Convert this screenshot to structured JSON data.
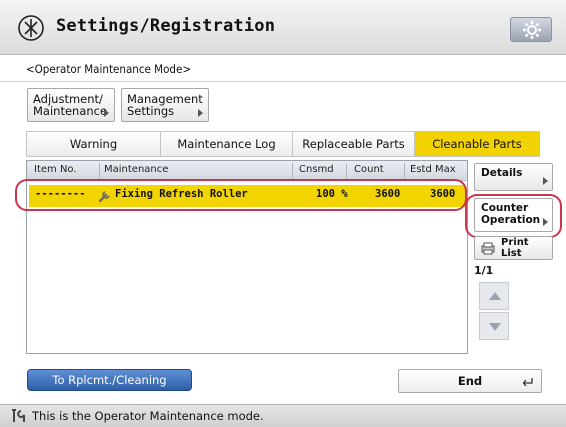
{
  "header": {
    "title": "Settings/Registration",
    "icon": "settings-registration-icon",
    "gear_button_icon": "gear-icon"
  },
  "mode_label": "<Operator Maintenance Mode>",
  "menu": {
    "adjustment_line1": "Adjustment/",
    "adjustment_line2": "Maintenance",
    "management_line1": "Management",
    "management_line2": "Settings"
  },
  "tabs": [
    {
      "label": "Warning",
      "active": false
    },
    {
      "label": "Maintenance Log",
      "active": false
    },
    {
      "label": "Replaceable Parts",
      "active": false
    },
    {
      "label": "Cleanable Parts",
      "active": true
    }
  ],
  "list": {
    "columns": [
      "Item No.",
      "Maintenance",
      "Cnsmd",
      "Count",
      "Estd Max"
    ],
    "rows": [
      {
        "item_no": "--------",
        "icon": "wrench-icon",
        "maintenance": "Fixing Refresh Roller",
        "cnsmd": "100 %",
        "count": "3600",
        "estd_max": "3600",
        "selected": true
      }
    ]
  },
  "side_buttons": {
    "details": "Details",
    "counter_line1": "Counter",
    "counter_line2": "Operation",
    "print_line1": "Print",
    "print_line2": "List"
  },
  "page_indicator": "1/1",
  "bottom": {
    "rplc_button": "To Rplcmt./Cleaning",
    "end_button": "End"
  },
  "status": {
    "text": "This is the Operator Maintenance mode.",
    "icon": "tools-icon"
  },
  "colors": {
    "accent_yellow": "#f2d200",
    "highlight_ring": "#c8374f",
    "primary_blue": "#2d5ea8"
  }
}
